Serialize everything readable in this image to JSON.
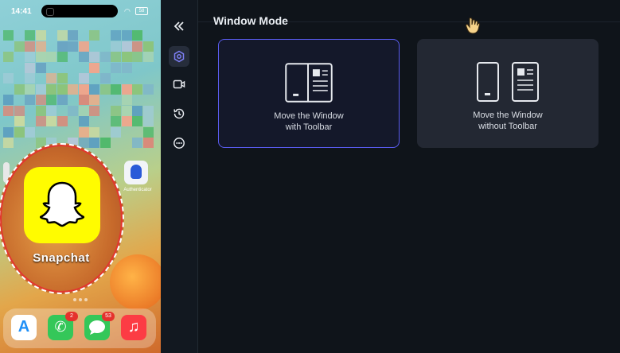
{
  "phone": {
    "time": "14:41",
    "battery": "58",
    "authenticator_label": "Authenticator",
    "snapchat_label": "Snapchat",
    "dock": [
      {
        "name": "app-store",
        "color": "#1e8ff7",
        "glyph": "A",
        "badge": ""
      },
      {
        "name": "phone",
        "color": "#34c759",
        "glyph": "✆",
        "badge": "2"
      },
      {
        "name": "messages",
        "color": "#34c759",
        "glyph": "💬",
        "badge": "53"
      },
      {
        "name": "music",
        "color": "#fc3c44",
        "glyph": "♫",
        "badge": ""
      }
    ]
  },
  "sidebar": {
    "items": [
      {
        "icon": "double-chevron-left-icon",
        "active": false
      },
      {
        "icon": "settings-icon",
        "active": true
      },
      {
        "icon": "video-camera-icon",
        "active": false
      },
      {
        "icon": "history-icon",
        "active": false
      },
      {
        "icon": "more-icon",
        "active": false
      }
    ]
  },
  "main": {
    "section_title": "Window Mode",
    "cards": [
      {
        "line1": "Move the Window",
        "line2": "with Toolbar",
        "selected": true
      },
      {
        "line1": "Move the Window",
        "line2": "without Toolbar",
        "selected": false
      }
    ]
  },
  "colors": {
    "accent": "#5a5cf0",
    "card_bg": "#232833",
    "selected_bg": "#14182a",
    "background": "#0f141a"
  }
}
